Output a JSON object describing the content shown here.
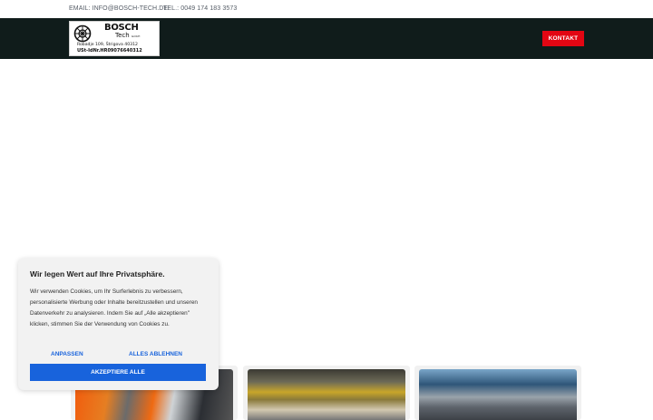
{
  "topbar": {
    "email": "EMAIL: INFO@BOSCH-TECH.DE",
    "phone": "TEL.: 0049 174 183 3573"
  },
  "header": {
    "logo": {
      "brand": "BOSCH",
      "brand_sub": "Tech",
      "brand_suffix": "GmbH",
      "address_line": "Robadje 109,           Štrigova 40312",
      "vat_line": "USt-IdNr.HR09076640312"
    },
    "contact_label": "KONTAKT"
  },
  "cookie_banner": {
    "title": "Wir legen Wert auf Ihre Privatsphäre.",
    "body": "Wir verwenden Cookies, um Ihr Surferlebnis zu verbessern, personalisierte Werbung oder Inhalte bereitzustellen und unseren Datenverkehr zu analysieren. Indem Sie auf „Alle akzeptieren\" klicken, stimmen Sie der Verwendung von Cookies zu.",
    "customize_label": "ANPASSEN",
    "reject_label": "ALLES ABLEHNEN",
    "accept_label": "AKZEPTIERE ALLE"
  },
  "colors": {
    "header_bg": "#101c1b",
    "contact_button": "#e30613",
    "cookie_accent": "#1863dc"
  }
}
